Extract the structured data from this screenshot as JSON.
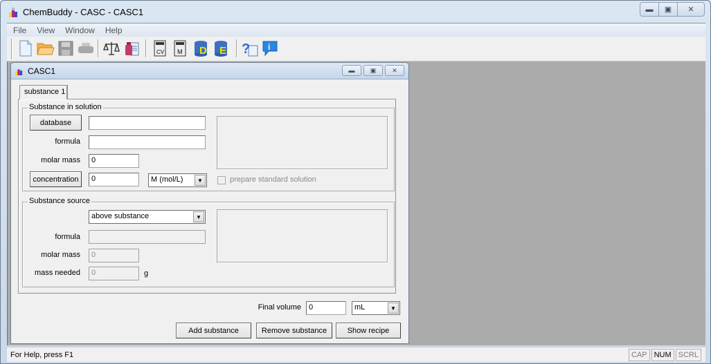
{
  "window": {
    "title": "ChemBuddy - CASC - CASC1"
  },
  "menu": [
    "File",
    "View",
    "Window",
    "Help"
  ],
  "toolbar": [
    {
      "name": "new-document-icon"
    },
    {
      "name": "open-folder-icon"
    },
    {
      "name": "save-icon"
    },
    {
      "name": "print-icon"
    },
    {
      "name": "balance-scale-icon"
    },
    {
      "name": "substance-report-icon"
    },
    {
      "name": "calculator-cv-icon"
    },
    {
      "name": "calculator-m-icon"
    },
    {
      "name": "database-d-icon"
    },
    {
      "name": "database-e-icon"
    },
    {
      "name": "help-context-icon"
    },
    {
      "name": "info-icon"
    }
  ],
  "child": {
    "title": "CASC1",
    "tab": "substance 1",
    "solution": {
      "group_label": "Substance in solution",
      "database_button": "database",
      "database_value": "",
      "formula_label": "formula",
      "formula_value": "",
      "molar_mass_label": "molar mass",
      "molar_mass_value": "0",
      "concentration_button": "concentration",
      "concentration_value": "0",
      "unit_selected": "M (mol/L)",
      "standard_checkbox_label": "prepare standard solution"
    },
    "source": {
      "group_label": "Substance source",
      "source_selected": "above substance",
      "formula_label": "formula",
      "formula_value": "",
      "molar_mass_label": "molar mass",
      "molar_mass_value": "0",
      "mass_needed_label": "mass needed",
      "mass_needed_value": "0",
      "mass_unit": "g"
    },
    "final_volume_label": "Final volume",
    "final_volume_value": "0",
    "volume_unit_selected": "mL",
    "buttons": {
      "add": "Add substance",
      "remove": "Remove substance",
      "recipe": "Show recipe"
    }
  },
  "status": {
    "help_text": "For Help, press F1",
    "indicators": [
      {
        "label": "CAP",
        "on": false
      },
      {
        "label": "NUM",
        "on": true
      },
      {
        "label": "SCRL",
        "on": false
      }
    ]
  }
}
